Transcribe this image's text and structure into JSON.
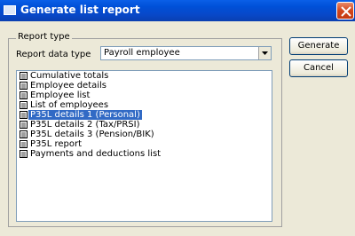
{
  "window": {
    "title": "Generate list report",
    "close_icon": "close-icon"
  },
  "group": {
    "label": "Report type"
  },
  "report_data_type": {
    "label": "Report data type",
    "value": "Payroll employee"
  },
  "report_list": {
    "items": [
      {
        "label": "Cumulative totals",
        "selected": false
      },
      {
        "label": "Employee details",
        "selected": false
      },
      {
        "label": "Employee list",
        "selected": false
      },
      {
        "label": "List of employees",
        "selected": false
      },
      {
        "label": "P35L details 1 (Personal)",
        "selected": true
      },
      {
        "label": "P35L details 2 (Tax/PRSI)",
        "selected": false
      },
      {
        "label": "P35L details 3 (Pension/BIK)",
        "selected": false
      },
      {
        "label": "P35L report",
        "selected": false
      },
      {
        "label": "Payments and deductions list",
        "selected": false
      }
    ]
  },
  "buttons": {
    "generate": "Generate",
    "cancel": "Cancel"
  },
  "colors": {
    "titlebar": "#0054e3",
    "selection": "#316ac5",
    "dialog_bg": "#ece9d8",
    "close": "#d2461d"
  }
}
